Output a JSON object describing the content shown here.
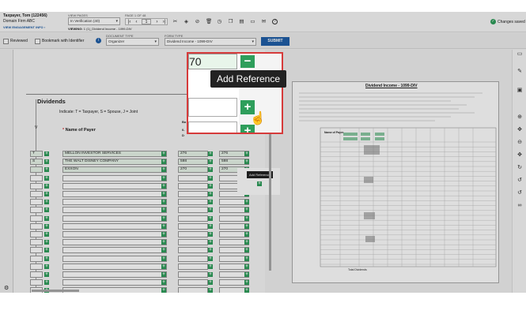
{
  "header": {
    "client": "Taxpayer, Tom (122456)",
    "firm": "Domain Firm ABC",
    "engagement_link": "VIEW ENGAGEMENT INFO ›",
    "view_pages_label": "VIEW PAGES",
    "view_pages_value": "In Verification (40)",
    "page_label": "PAGE 1 OF 48",
    "page_number": "1",
    "viewing_label": "VIEWING:",
    "viewing_value": "1 (1)_Dividend Income - 1099-DIV",
    "saved": "Changes saved"
  },
  "subbar": {
    "reviewed": "Reviewed",
    "bookmark": "Bookmark with Identifier",
    "doctype_label": "DOCUMENT TYPE",
    "doctype_value": "Organizer",
    "formtype_label": "FORM TYPE",
    "formtype_value": "Dividend Income - 1099-DIV",
    "submit": "SUBMIT"
  },
  "form": {
    "section": "Dividends",
    "indicate": "Indicate: T = Taxpayer, S = Spouse, J = Joint",
    "col_v": "V",
    "col_payer": "Name of Payer",
    "col_bo": "Bo",
    "col_0": "0-",
    "col_d": "D",
    "rows": [
      {
        "tsj": "T",
        "payer": "MELLON INVESTOR SERVICES",
        "a": "276",
        "b": "276"
      },
      {
        "tsj": "S",
        "payer": "THE WALT DISNEY COMPANY",
        "a": "598",
        "b": "598"
      },
      {
        "tsj": "",
        "payer": "EXXON",
        "a": "270",
        "b": "270"
      }
    ],
    "small_tooltip": "Add Reference"
  },
  "zoom": {
    "value": "70",
    "tooltip": "Add Reference"
  },
  "doc": {
    "title": "Dividend Income - 1099-DIV",
    "footer": "Total Dividends",
    "payer_heading": "Name of Payer"
  }
}
